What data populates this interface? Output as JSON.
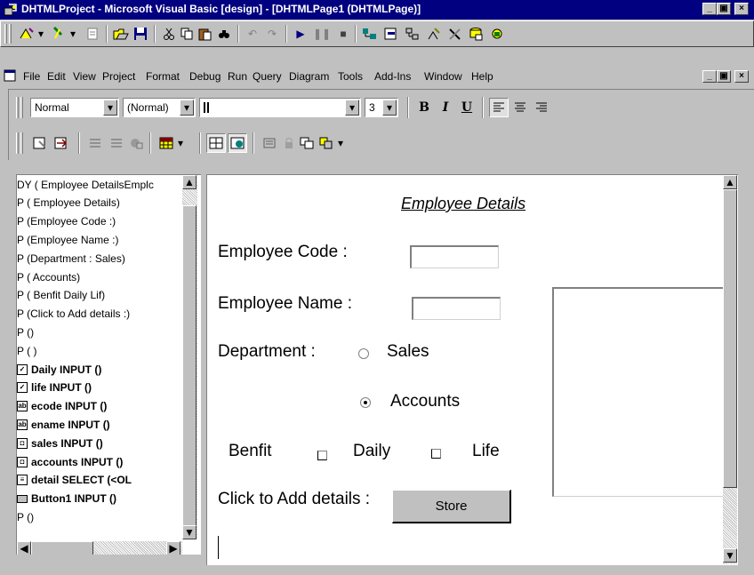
{
  "window": {
    "title": "DHTMLProject - Microsoft Visual Basic [design] - [DHTMLPage1 (DHTMLPage)]",
    "minimize": "_",
    "restore": "▣",
    "close": "×"
  },
  "menu": {
    "items": [
      {
        "label": "File"
      },
      {
        "label": "Edit"
      },
      {
        "label": "View"
      },
      {
        "label": "Project"
      },
      {
        "label": "Format"
      },
      {
        "label": "Debug"
      },
      {
        "label": "Run"
      },
      {
        "label": "Query"
      },
      {
        "label": "Diagram"
      },
      {
        "label": "Tools"
      },
      {
        "label": "Add-Ins"
      },
      {
        "label": "Window"
      },
      {
        "label": "Help"
      }
    ]
  },
  "format_toolbar": {
    "paragraph_style": "Normal",
    "font_face": "(Normal)",
    "font_name": "",
    "font_size": "3",
    "bold": "B",
    "italic": "I",
    "underline": "U"
  },
  "tree": {
    "items": [
      {
        "label": "DY ( Employee DetailsEmplc",
        "icon": "none",
        "bold": false
      },
      {
        "label": "P ( Employee Details)",
        "icon": "none",
        "bold": false
      },
      {
        "label": "P (Employee Code :)",
        "icon": "none",
        "bold": false
      },
      {
        "label": "P (Employee Name :)",
        "icon": "none",
        "bold": false
      },
      {
        "label": "P (Department : Sales)",
        "icon": "none",
        "bold": false
      },
      {
        "label": "P ( Accounts)",
        "icon": "none",
        "bold": false
      },
      {
        "label": "P ( Benfit Daily Lif)",
        "icon": "none",
        "bold": false
      },
      {
        "label": "P (Click to Add details :)",
        "icon": "none",
        "bold": false
      },
      {
        "label": "P ()",
        "icon": "none",
        "bold": false
      },
      {
        "label": "P ( )",
        "icon": "none",
        "bold": false
      },
      {
        "label": "Daily INPUT ()",
        "icon": "checkbox-icon",
        "bold": true
      },
      {
        "label": "life INPUT ()",
        "icon": "checkbox-icon",
        "bold": true
      },
      {
        "label": "ecode INPUT ()",
        "icon": "textbox-icon",
        "bold": true
      },
      {
        "label": "ename INPUT ()",
        "icon": "textbox-icon",
        "bold": true
      },
      {
        "label": "sales INPUT ()",
        "icon": "option-icon",
        "bold": true
      },
      {
        "label": "accounts INPUT ()",
        "icon": "option-icon",
        "bold": true
      },
      {
        "label": "detail SELECT (<OL",
        "icon": "select-icon",
        "bold": true
      },
      {
        "label": "Button1 INPUT ()",
        "icon": "button-icon",
        "bold": true
      },
      {
        "label": "P ()",
        "icon": "none",
        "bold": false
      }
    ]
  },
  "form": {
    "heading": "Employee Details",
    "code_label": "Employee Code :",
    "name_label": "Employee Name :",
    "dept_label": "Department :",
    "sales_label": "Sales",
    "accounts_label": "Accounts",
    "benefit_label": "Benfit",
    "daily_label": "Daily",
    "life_label": "Life",
    "add_label": "Click to Add details :",
    "store_button": "Store",
    "employee_code_value": "",
    "employee_name_value": ""
  },
  "colors": {
    "titlebar": "#000080",
    "face": "#c0c0c0"
  }
}
